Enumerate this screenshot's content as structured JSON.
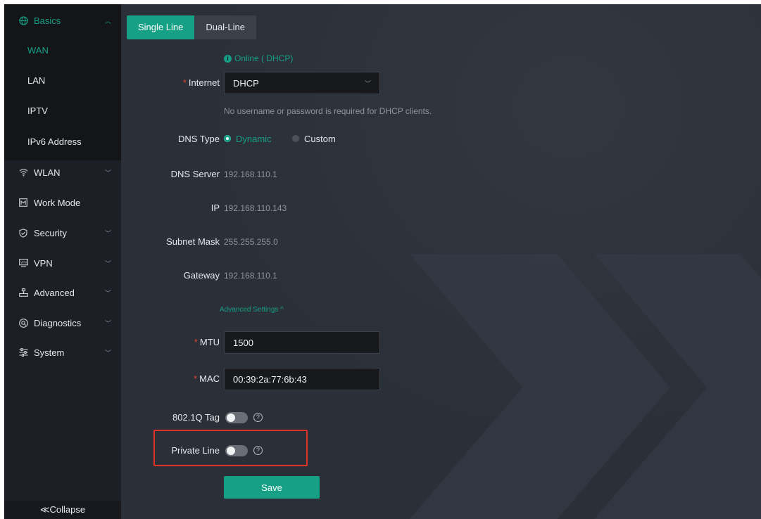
{
  "sidebar": {
    "basics": {
      "label": "Basics",
      "icon": "globe-icon"
    },
    "sub_items": [
      "WAN",
      "LAN",
      "IPTV",
      "IPv6 Address"
    ],
    "items": [
      {
        "label": "WLAN",
        "icon": "wifi-icon"
      },
      {
        "label": "Work Mode",
        "icon": "work-mode-icon"
      },
      {
        "label": "Security",
        "icon": "shield-icon"
      },
      {
        "label": "VPN",
        "icon": "vpn-icon"
      },
      {
        "label": "Advanced",
        "icon": "advanced-icon"
      },
      {
        "label": "Diagnostics",
        "icon": "diagnostics-icon"
      },
      {
        "label": "System",
        "icon": "system-icon"
      }
    ],
    "collapse_label": "≪Collapse"
  },
  "tabs": {
    "single": "Single Line",
    "dual": "Dual-Line"
  },
  "status": "Online ( DHCP)",
  "internet": {
    "label": "Internet",
    "value": "DHCP"
  },
  "dhcp_note": "No username or password is required for DHCP clients.",
  "dns_type": {
    "label": "DNS Type",
    "options": [
      "Dynamic",
      "Custom"
    ],
    "selected": "Dynamic"
  },
  "dns_server": {
    "label": "DNS Server",
    "value": "192.168.110.1"
  },
  "ip": {
    "label": "IP",
    "value": "192.168.110.143"
  },
  "subnet_mask": {
    "label": "Subnet Mask",
    "value": "255.255.255.0"
  },
  "gateway": {
    "label": "Gateway",
    "value": "192.168.110.1"
  },
  "advanced_settings": "Advanced Settings ^",
  "mtu": {
    "label": "MTU",
    "value": "1500"
  },
  "mac": {
    "label": "MAC",
    "value": "00:39:2a:77:6b:43"
  },
  "tag_8021q": {
    "label": "802.1Q Tag",
    "enabled": false
  },
  "private_line": {
    "label": "Private Line",
    "enabled": false
  },
  "save_label": "Save",
  "colors": {
    "accent": "#16a085",
    "highlight": "#e0302a"
  }
}
